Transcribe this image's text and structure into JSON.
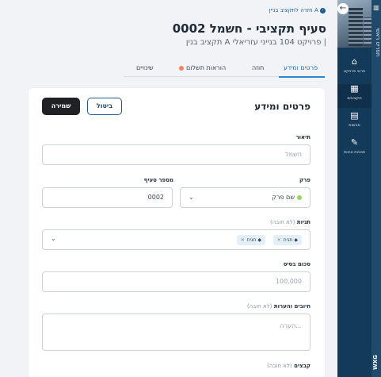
{
  "rail": {
    "top_icon": "building-icon",
    "text": "תפריט ראשי",
    "logo": "WXG"
  },
  "sidebar": {
    "back_icon": "arrow-left-icon",
    "items": [
      {
        "icon": "project-info-icon",
        "label": "פרטי פרויקט",
        "active": false
      },
      {
        "icon": "budget-icon",
        "label": "תקציבים",
        "active": true
      },
      {
        "icon": "calendar-icon",
        "label": "פגישות",
        "active": false
      },
      {
        "icon": "document-icon",
        "label": "תכניות איכות",
        "active": false
      }
    ]
  },
  "header": {
    "breadcrumb": "חזרה לתקציב בניין A",
    "title": "סעיף תקציבי - חשמל 0002",
    "subtitle": "תקציב בנין A פרויקט 104 בנייני עזריאלי |"
  },
  "tabs": [
    {
      "label": "פרטים ומידע",
      "active": true,
      "dot": false
    },
    {
      "label": "חוזה",
      "active": false,
      "dot": false
    },
    {
      "label": "הוראות תשלום",
      "active": false,
      "dot": true
    },
    {
      "label": "שינויים",
      "active": false,
      "dot": false
    }
  ],
  "card": {
    "title": "פרטים ומידע",
    "save_label": "שמירה",
    "cancel_label": "ביטול"
  },
  "form": {
    "description": {
      "label": "תיאור",
      "placeholder": "חשמל"
    },
    "chapter": {
      "label": "פרק",
      "value": "שם פרק"
    },
    "item_number": {
      "label": "מספר סעיף",
      "value": "0002"
    },
    "tags": {
      "label": "תגיות",
      "optional": "(לא חובה)",
      "chips": [
        "תגית",
        "תגית"
      ]
    },
    "base_amount": {
      "label": "סכום בסיס",
      "placeholder": "100,000"
    },
    "notes": {
      "label": "חיובים והערות",
      "optional": "(לא חובה)",
      "placeholder": "הערה..."
    },
    "files": {
      "label": "קבצים",
      "optional": "(לא חובה)"
    }
  },
  "colors": {
    "accent": "#2d87d0",
    "sidebar": "#143a5a",
    "save_button": "#202124",
    "status_dot": "#f0845a",
    "chapter_dot": "#9bd45c"
  }
}
